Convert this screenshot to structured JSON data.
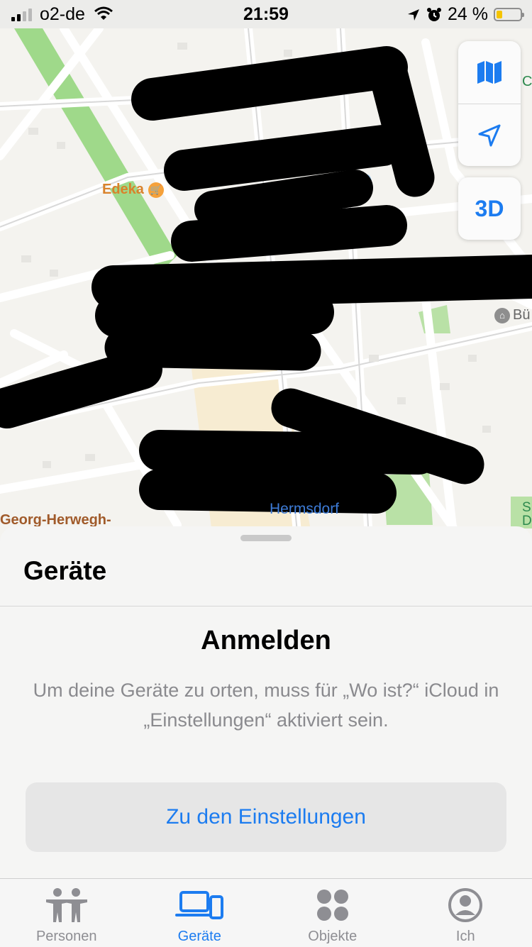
{
  "status_bar": {
    "carrier": "o2-de",
    "time": "21:59",
    "battery_percent": "24 %",
    "battery_level": 0.24
  },
  "map": {
    "labels": {
      "edeka": "Edeka",
      "georg": "Georg-Herwegh-",
      "bu": "Bü",
      "hermsdorf": "Hermsdorf",
      "s": "S",
      "d": "D",
      "c": "C"
    },
    "controls": {
      "map_mode_icon": "map-icon",
      "location_icon": "location-arrow-icon",
      "three_d_label": "3D"
    }
  },
  "sheet": {
    "title": "Geräte",
    "heading": "Anmelden",
    "description": "Um deine Geräte zu orten, muss für „Wo ist?“ iCloud in „Einstellungen“ aktiviert sein.",
    "button_label": "Zu den Einstellungen"
  },
  "tab_bar": {
    "tabs": [
      {
        "label": "Personen",
        "icon": "people-icon",
        "active": false
      },
      {
        "label": "Geräte",
        "icon": "devices-icon",
        "active": true
      },
      {
        "label": "Objekte",
        "icon": "items-icon",
        "active": false
      },
      {
        "label": "Ich",
        "icon": "me-icon",
        "active": false
      }
    ]
  },
  "colors": {
    "accent": "#1c7cf0",
    "inactive_tab": "#8e8e93",
    "redaction": "#000000"
  }
}
